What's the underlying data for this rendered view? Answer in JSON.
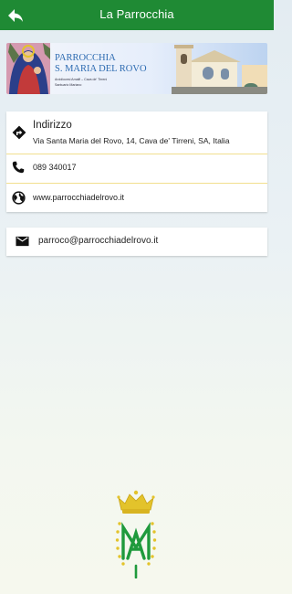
{
  "header": {
    "title": "La Parrocchia",
    "back_icon": "arrow-left-icon",
    "color": "#1f8a34"
  },
  "banner": {
    "line1": "PARROCCHIA",
    "line2": "S. MARIA DEL ROVO",
    "line3": "Arcidiocesi Amalfi – Cava de' Tirreni",
    "line4": "Santuario Mariano"
  },
  "contact": {
    "address_label": "Indirizzo",
    "address_value": "Via Santa Maria del Rovo, 14, Cava de' Tirreni, SA, Italia",
    "phone": "089 340017",
    "website": "www.parrocchiadelrovo.it",
    "icons": [
      "directions-icon",
      "phone-icon",
      "globe-icon"
    ]
  },
  "email": {
    "address": "parroco@parrocchiadelrovo.it",
    "icon": "mail-icon"
  },
  "colors": {
    "divider": "#f1df8e",
    "logo_gold": "#e3c32b",
    "logo_green": "#1f9a3c"
  }
}
